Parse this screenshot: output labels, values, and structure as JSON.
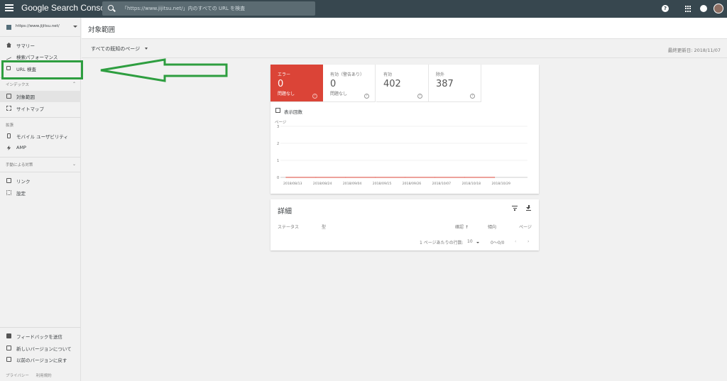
{
  "app": {
    "brand": "Google Search Console"
  },
  "search": {
    "placeholder": "「https://www.jijitsu.net/」内のすべての URL を検査"
  },
  "sidebar": {
    "property": "https://www.jijitsu.net/",
    "items_top": [
      {
        "label": "サマリー",
        "icon": "home-icon"
      },
      {
        "label": "検索パフォーマンス",
        "icon": "trending-icon"
      },
      {
        "label": "URL 検査",
        "icon": "search-icon"
      }
    ],
    "section_index": "インデックス",
    "items_index": [
      {
        "label": "対象範囲",
        "icon": "document-icon",
        "active": true
      },
      {
        "label": "サイトマップ",
        "icon": "sitemap-icon"
      }
    ],
    "section_ext": "拡張",
    "items_ext": [
      {
        "label": "モバイル ユーザビリティ",
        "icon": "phone-icon"
      },
      {
        "label": "AMP",
        "icon": "bolt-icon"
      }
    ],
    "section_manual": "手動による対策",
    "items_misc": [
      {
        "label": "リンク",
        "icon": "link-icon"
      },
      {
        "label": "設定",
        "icon": "gear-icon"
      }
    ],
    "items_bottom": [
      {
        "label": "フィードバックを送信",
        "icon": "feedback-icon"
      },
      {
        "label": "新しいバージョンについて",
        "icon": "info-icon"
      },
      {
        "label": "以前のバージョンに戻す",
        "icon": "back-icon"
      }
    ],
    "footer": {
      "privacy": "プライバシー",
      "terms": "利用規約"
    }
  },
  "header": {
    "title": "対象範囲"
  },
  "filter": {
    "selected": "すべての既知のページ",
    "updated": "最終更新日: 2018/11/07"
  },
  "tiles": [
    {
      "label": "エラー",
      "value": "0",
      "sub": "問題なし"
    },
    {
      "label": "有効（警告あり）",
      "value": "0",
      "sub": "問題なし"
    },
    {
      "label": "有効",
      "value": "402",
      "sub": ""
    },
    {
      "label": "除外",
      "value": "387",
      "sub": ""
    }
  ],
  "impressions_checkbox": "表示回数",
  "chart_data": {
    "type": "line",
    "ylabel": "ページ",
    "yticks": [
      "0",
      "1",
      "2",
      "3"
    ],
    "ylim": [
      0,
      3
    ],
    "x": [
      "2018/08/13",
      "2018/08/24",
      "2018/09/04",
      "2018/09/15",
      "2018/09/26",
      "2018/10/07",
      "2018/10/18",
      "2018/10/29"
    ],
    "series": [
      {
        "values": [
          0,
          0,
          0,
          0,
          0,
          0,
          0,
          0
        ]
      }
    ],
    "grid": true
  },
  "details": {
    "title": "詳細",
    "columns": [
      "ステータス",
      "型",
      "確認",
      "傾向",
      "ページ"
    ],
    "rows_per_page_label": "1 ページあたりの行数:",
    "rows_per_page": "10",
    "range": "0～0/0"
  },
  "colors": {
    "topbar": "#37474f",
    "error": "#db4437",
    "highlight": "#2e9e40"
  }
}
